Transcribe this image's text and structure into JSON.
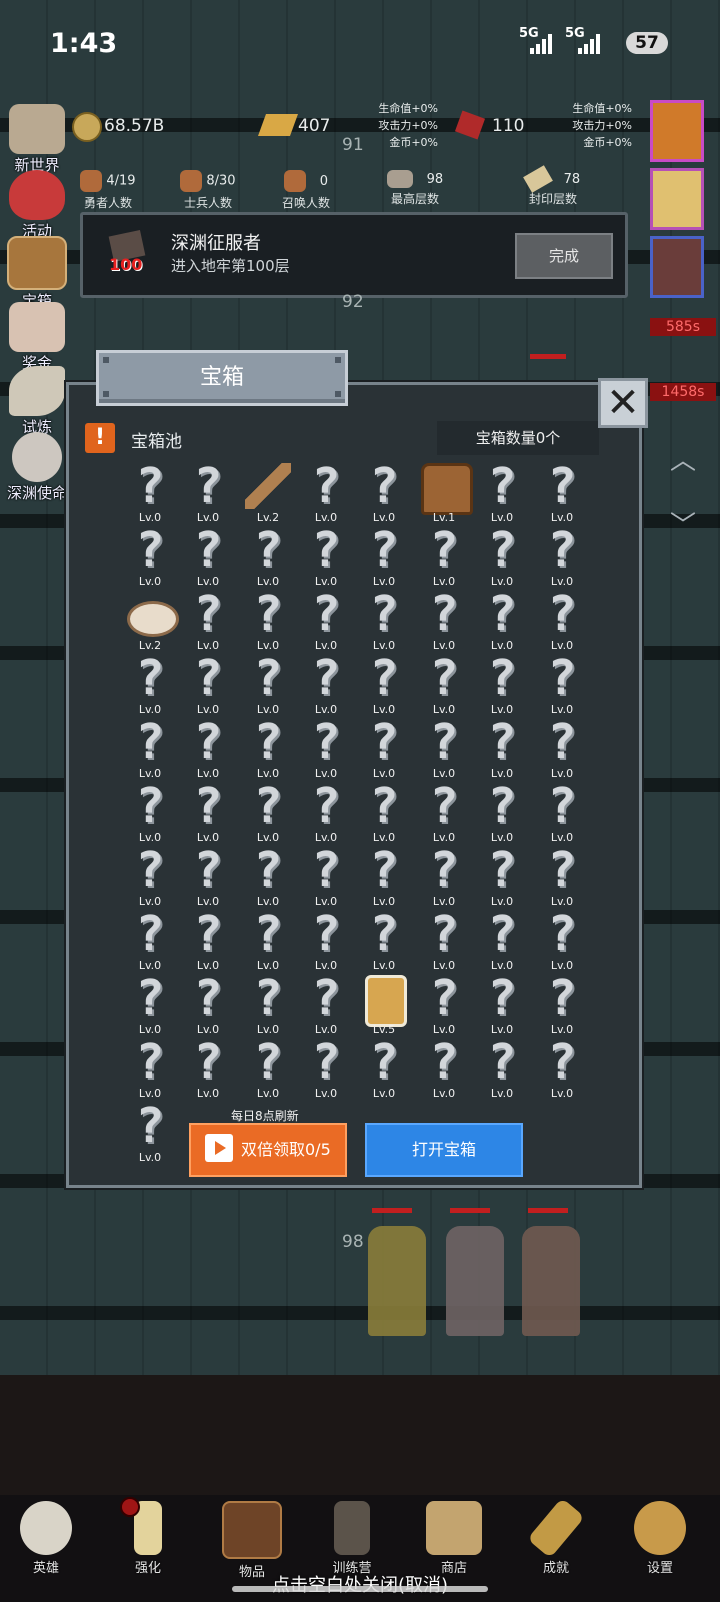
{
  "status_bar": {
    "time": "1:43",
    "net1": "5G",
    "net2": "5G",
    "battery": "57"
  },
  "resources": {
    "gold": "68.57B",
    "bars": "407",
    "gems": "110",
    "bonus_left": [
      "生命值+0%",
      "攻击力+0%",
      "金币+0%"
    ],
    "bonus_right": [
      "生命值+0%",
      "攻击力+0%",
      "金币+0%"
    ]
  },
  "stats": [
    {
      "value": "4/19",
      "label": "勇者人数"
    },
    {
      "value": "8/30",
      "label": "士兵人数"
    },
    {
      "value": "0",
      "label": "召唤人数"
    },
    {
      "value": "98",
      "label": "最高层数"
    },
    {
      "value": "78",
      "label": "封印层数"
    }
  ],
  "floor_numbers": {
    "f91": "91",
    "f92": "92",
    "f98": "98"
  },
  "left_menu": [
    "新世界",
    "活动",
    "宝箱",
    "奖金",
    "试炼",
    "深渊使命"
  ],
  "right_timers": [
    "585s",
    "1458s"
  ],
  "achievement": {
    "badge": "100",
    "title": "深渊征服者",
    "desc": "进入地牢第100层",
    "button": "完成"
  },
  "dialog": {
    "title": "宝箱",
    "warn": "!",
    "pool_label": "宝箱池",
    "count": "宝箱数量0个",
    "refresh_label": "每日8点刷新",
    "double_button": "双倍领取0/5",
    "open_button": "打开宝箱",
    "close": "✕"
  },
  "grid_items": [
    {
      "lv": "Lv.0",
      "item": null
    },
    {
      "lv": "Lv.0",
      "item": null
    },
    {
      "lv": "Lv.2",
      "item": "sword"
    },
    {
      "lv": "Lv.0",
      "item": null
    },
    {
      "lv": "Lv.0",
      "item": null
    },
    {
      "lv": "Lv.1",
      "item": "armor"
    },
    {
      "lv": "Lv.0",
      "item": null
    },
    {
      "lv": "Lv.0",
      "item": null
    },
    {
      "lv": "Lv.0",
      "item": null
    },
    {
      "lv": "Lv.0",
      "item": null
    },
    {
      "lv": "Lv.0",
      "item": null
    },
    {
      "lv": "Lv.0",
      "item": null
    },
    {
      "lv": "Lv.0",
      "item": null
    },
    {
      "lv": "Lv.0",
      "item": null
    },
    {
      "lv": "Lv.0",
      "item": null
    },
    {
      "lv": "Lv.0",
      "item": null
    },
    {
      "lv": "Lv.2",
      "item": "bread"
    },
    {
      "lv": "Lv.0",
      "item": null
    },
    {
      "lv": "Lv.0",
      "item": null
    },
    {
      "lv": "Lv.0",
      "item": null
    },
    {
      "lv": "Lv.0",
      "item": null
    },
    {
      "lv": "Lv.0",
      "item": null
    },
    {
      "lv": "Lv.0",
      "item": null
    },
    {
      "lv": "Lv.0",
      "item": null
    },
    {
      "lv": "Lv.0",
      "item": null
    },
    {
      "lv": "Lv.0",
      "item": null
    },
    {
      "lv": "Lv.0",
      "item": null
    },
    {
      "lv": "Lv.0",
      "item": null
    },
    {
      "lv": "Lv.0",
      "item": null
    },
    {
      "lv": "Lv.0",
      "item": null
    },
    {
      "lv": "Lv.0",
      "item": null
    },
    {
      "lv": "Lv.0",
      "item": null
    },
    {
      "lv": "Lv.0",
      "item": null
    },
    {
      "lv": "Lv.0",
      "item": null
    },
    {
      "lv": "Lv.0",
      "item": null
    },
    {
      "lv": "Lv.0",
      "item": null
    },
    {
      "lv": "Lv.0",
      "item": null
    },
    {
      "lv": "Lv.0",
      "item": null
    },
    {
      "lv": "Lv.0",
      "item": null
    },
    {
      "lv": "Lv.0",
      "item": null
    },
    {
      "lv": "Lv.0",
      "item": null
    },
    {
      "lv": "Lv.0",
      "item": null
    },
    {
      "lv": "Lv.0",
      "item": null
    },
    {
      "lv": "Lv.0",
      "item": null
    },
    {
      "lv": "Lv.0",
      "item": null
    },
    {
      "lv": "Lv.0",
      "item": null
    },
    {
      "lv": "Lv.0",
      "item": null
    },
    {
      "lv": "Lv.0",
      "item": null
    },
    {
      "lv": "Lv.0",
      "item": null
    },
    {
      "lv": "Lv.0",
      "item": null
    },
    {
      "lv": "Lv.0",
      "item": null
    },
    {
      "lv": "Lv.0",
      "item": null
    },
    {
      "lv": "Lv.0",
      "item": null
    },
    {
      "lv": "Lv.0",
      "item": null
    },
    {
      "lv": "Lv.0",
      "item": null
    },
    {
      "lv": "Lv.0",
      "item": null
    },
    {
      "lv": "Lv.0",
      "item": null
    },
    {
      "lv": "Lv.0",
      "item": null
    },
    {
      "lv": "Lv.0",
      "item": null
    },
    {
      "lv": "Lv.0",
      "item": null
    },
    {
      "lv": "Lv.0",
      "item": null
    },
    {
      "lv": "Lv.0",
      "item": null
    },
    {
      "lv": "Lv.0",
      "item": null
    },
    {
      "lv": "Lv.0",
      "item": null
    },
    {
      "lv": "Lv.0",
      "item": null
    },
    {
      "lv": "Lv.0",
      "item": null
    },
    {
      "lv": "Lv.0",
      "item": null
    },
    {
      "lv": "Lv.0",
      "item": null
    },
    {
      "lv": "Lv.5",
      "item": "beer"
    },
    {
      "lv": "Lv.0",
      "item": null
    },
    {
      "lv": "Lv.0",
      "item": null
    },
    {
      "lv": "Lv.0",
      "item": null
    },
    {
      "lv": "Lv.0",
      "item": null
    },
    {
      "lv": "Lv.0",
      "item": null
    },
    {
      "lv": "Lv.0",
      "item": null
    },
    {
      "lv": "Lv.0",
      "item": null
    },
    {
      "lv": "Lv.0",
      "item": null
    },
    {
      "lv": "Lv.0",
      "item": null
    },
    {
      "lv": "Lv.0",
      "item": null
    },
    {
      "lv": "Lv.0",
      "item": null
    },
    {
      "lv": "Lv.0",
      "item": null
    }
  ],
  "bottom_nav": [
    "英雄",
    "强化",
    "物品",
    "训练营",
    "商店",
    "成就",
    "设置"
  ],
  "close_hint": "点击空白处关闭(取消)"
}
